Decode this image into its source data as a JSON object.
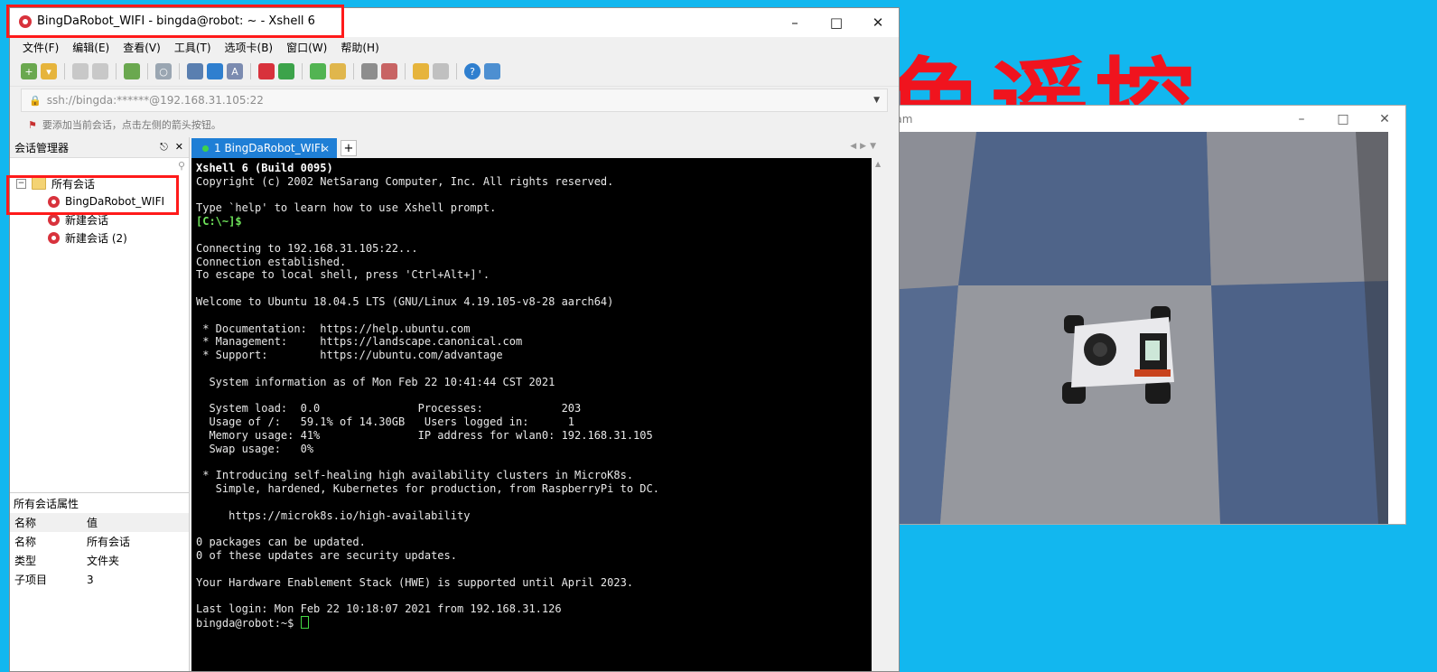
{
  "background_text": "鱼遥控",
  "xshell": {
    "title": "BingDaRobot_WIFI - bingda@robot: ~ - Xshell 6",
    "menu": [
      "文件(F)",
      "编辑(E)",
      "查看(V)",
      "工具(T)",
      "选项卡(B)",
      "窗口(W)",
      "帮助(H)"
    ],
    "address": "ssh://bingda:******@192.168.31.105:22",
    "hint": "要添加当前会话，点击左侧的箭头按钮。",
    "session_manager": {
      "title": "会话管理器",
      "root": "所有会话",
      "sessions": [
        "BingDaRobot_WIFI",
        "新建会话",
        "新建会话 (2)"
      ]
    },
    "properties": {
      "title": "所有会话属性",
      "headers": [
        "名称",
        "值"
      ],
      "rows": [
        {
          "k": "名称",
          "v": "所有会话"
        },
        {
          "k": "类型",
          "v": "文件夹"
        },
        {
          "k": "子项目",
          "v": "3"
        }
      ]
    },
    "tab": {
      "label": "1 BingDaRobot_WIFI",
      "close": "×",
      "add": "+"
    },
    "terminal": {
      "header": "Xshell 6 (Build 0095)",
      "lines1": "Copyright (c) 2002 NetSarang Computer, Inc. All rights reserved.\n\nType `help' to learn how to use Xshell prompt.",
      "local_prompt": "[C:\\~]$",
      "lines2": "\n\nConnecting to 192.168.31.105:22...\nConnection established.\nTo escape to local shell, press 'Ctrl+Alt+]'.\n\nWelcome to Ubuntu 18.04.5 LTS (GNU/Linux 4.19.105-v8-28 aarch64)\n\n * Documentation:  https://help.ubuntu.com\n * Management:     https://landscape.canonical.com\n * Support:        https://ubuntu.com/advantage\n\n  System information as of Mon Feb 22 10:41:44 CST 2021\n\n  System load:  0.0               Processes:            203\n  Usage of /:   59.1% of 14.30GB   Users logged in:      1\n  Memory usage: 41%               IP address for wlan0: 192.168.31.105\n  Swap usage:   0%\n\n * Introducing self-healing high availability clusters in MicroK8s.\n   Simple, hardened, Kubernetes for production, from RaspberryPi to DC.\n\n     https://microk8s.io/high-availability\n\n0 packages can be updated.\n0 of these updates are security updates.\n\nYour Hardware Enablement Stack (HWE) is supported until April 2023.\n\nLast login: Mon Feb 22 10:18:07 2021 from 192.168.31.126\n",
      "prompt": "bingda@robot:~$ "
    }
  },
  "cam": {
    "title": "Cam"
  }
}
